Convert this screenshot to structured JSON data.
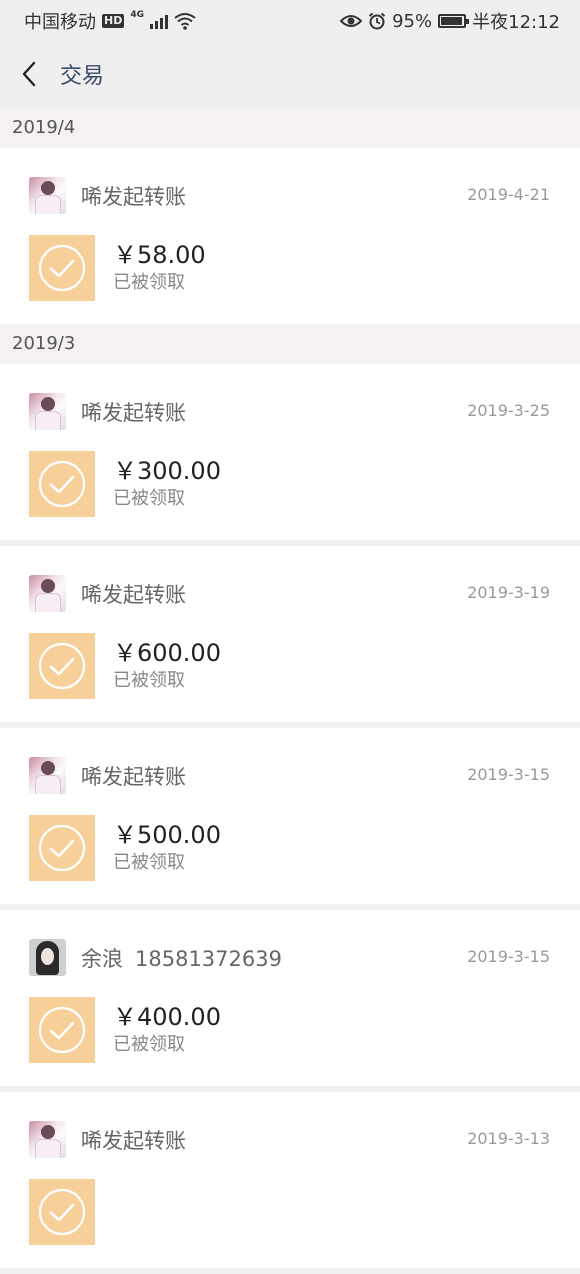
{
  "status_bar": {
    "carrier": "中国移动",
    "hd": "HD",
    "network": "4G",
    "battery": "95%",
    "battery_level": 0.95,
    "time": "半夜12:12"
  },
  "nav": {
    "title": "交易",
    "back_icon": "chevron-left-icon"
  },
  "groups": [
    {
      "month": "2019/4",
      "items": [
        {
          "name": "唏发起转账",
          "phone": "",
          "date": "2019-4-21",
          "amount": "￥58.00",
          "status": "已被领取",
          "avatar": "kid"
        }
      ]
    },
    {
      "month": "2019/3",
      "items": [
        {
          "name": "唏发起转账",
          "phone": "",
          "date": "2019-3-25",
          "amount": "￥300.00",
          "status": "已被领取",
          "avatar": "kid"
        },
        {
          "name": "唏发起转账",
          "phone": "",
          "date": "2019-3-19",
          "amount": "￥600.00",
          "status": "已被领取",
          "avatar": "kid"
        },
        {
          "name": "唏发起转账",
          "phone": "",
          "date": "2019-3-15",
          "amount": "￥500.00",
          "status": "已被领取",
          "avatar": "kid"
        },
        {
          "name": "余浪",
          "phone": "18581372639",
          "date": "2019-3-15",
          "amount": "￥400.00",
          "status": "已被领取",
          "avatar": "girl"
        },
        {
          "name": "唏发起转账",
          "phone": "",
          "date": "2019-3-13",
          "amount": "",
          "status": "",
          "avatar": "kid"
        }
      ]
    }
  ],
  "colors": {
    "accent_check_bg": "#f7cf98",
    "title_color": "#3b4a6b"
  },
  "icons": {
    "check": "check-circle-icon",
    "eye": "eye-icon",
    "alarm": "alarm-icon",
    "wifi": "wifi-icon",
    "signal": "signal-icon",
    "battery": "battery-icon"
  }
}
